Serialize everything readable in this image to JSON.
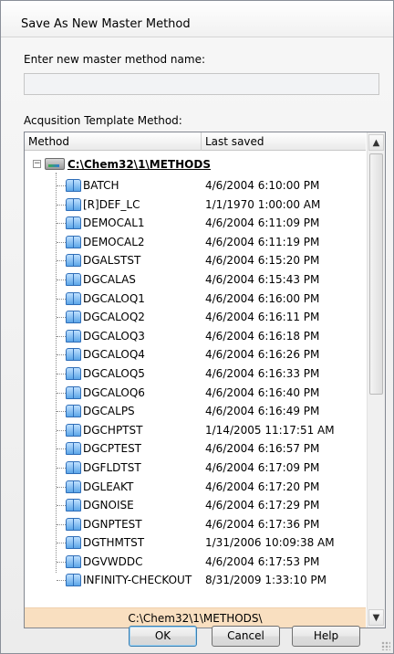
{
  "window": {
    "title": "Save As New Master Method"
  },
  "name_field": {
    "label": "Enter new master method name:",
    "value": "",
    "placeholder": ""
  },
  "template": {
    "label": "Acqusition Template Method:",
    "columns": {
      "method": "Method",
      "last_saved": "Last saved"
    },
    "root": {
      "label": "C:\\Chem32\\1\\METHODS",
      "expander": "−",
      "icon": "drive-icon"
    },
    "items": [
      {
        "name": "BATCH",
        "saved": "4/6/2004 6:10:00 PM"
      },
      {
        "name": "[R]DEF_LC",
        "saved": "1/1/1970 1:00:00 AM"
      },
      {
        "name": "DEMOCAL1",
        "saved": "4/6/2004 6:11:09 PM"
      },
      {
        "name": "DEMOCAL2",
        "saved": "4/6/2004 6:11:19 PM"
      },
      {
        "name": "DGALSTST",
        "saved": "4/6/2004 6:15:20 PM"
      },
      {
        "name": "DGCALAS",
        "saved": "4/6/2004 6:15:43 PM"
      },
      {
        "name": "DGCALOQ1",
        "saved": "4/6/2004 6:16:00 PM"
      },
      {
        "name": "DGCALOQ2",
        "saved": "4/6/2004 6:16:11 PM"
      },
      {
        "name": "DGCALOQ3",
        "saved": "4/6/2004 6:16:18 PM"
      },
      {
        "name": "DGCALOQ4",
        "saved": "4/6/2004 6:16:26 PM"
      },
      {
        "name": "DGCALOQ5",
        "saved": "4/6/2004 6:16:33 PM"
      },
      {
        "name": "DGCALOQ6",
        "saved": "4/6/2004 6:16:40 PM"
      },
      {
        "name": "DGCALPS",
        "saved": "4/6/2004 6:16:49 PM"
      },
      {
        "name": "DGCHPTST",
        "saved": "1/14/2005 11:17:51 AM"
      },
      {
        "name": "DGCPTEST",
        "saved": "4/6/2004 6:16:57 PM"
      },
      {
        "name": "DGFLDTST",
        "saved": "4/6/2004 6:17:09 PM"
      },
      {
        "name": "DGLEAKT",
        "saved": "4/6/2004 6:17:20 PM"
      },
      {
        "name": "DGNOISE",
        "saved": "4/6/2004 6:17:29 PM"
      },
      {
        "name": "DGNPTEST",
        "saved": "4/6/2004 6:17:36 PM"
      },
      {
        "name": "DGTHMTST",
        "saved": "1/31/2006 10:09:38 AM"
      },
      {
        "name": "DGVWDDC",
        "saved": "4/6/2004 6:17:53 PM"
      },
      {
        "name": "INFINITY-CHECKOUT",
        "saved": "8/31/2009 1:33:10 PM"
      }
    ],
    "item_icon": "method-book-icon",
    "selected_path": "C:\\Chem32\\1\\METHODS\\",
    "scroll": {
      "up_arrow": "▲",
      "down_arrow": "▼"
    }
  },
  "buttons": {
    "ok": "OK",
    "cancel": "Cancel",
    "help": "Help"
  }
}
